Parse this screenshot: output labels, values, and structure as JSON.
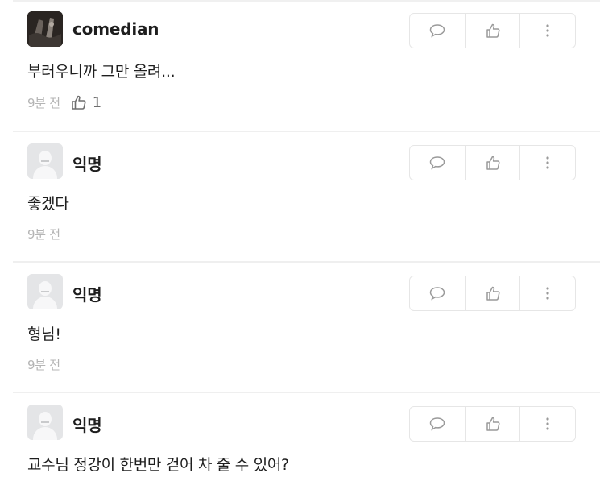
{
  "comments": [
    {
      "author": "comedian",
      "avatar": "photo",
      "text": "부러우니까 그만 올려...",
      "time": "9분 전",
      "likes": "1"
    },
    {
      "author": "익명",
      "avatar": "default",
      "text": "좋겠다",
      "time": "9분 전"
    },
    {
      "author": "익명",
      "avatar": "default",
      "text": "형님!",
      "time": "9분 전"
    },
    {
      "author": "익명",
      "avatar": "default",
      "text": "교수님 정강이 한번만 걷어 차 줄 수 있어?"
    }
  ],
  "icons": {
    "reply": "comment-bubble-icon",
    "like": "thumbs-up-icon",
    "more": "more-vertical-icon"
  },
  "colors": {
    "border": "#e6e6e6",
    "meta_text": "#b4b4b4",
    "avatar_default": "#e4e5e7"
  }
}
